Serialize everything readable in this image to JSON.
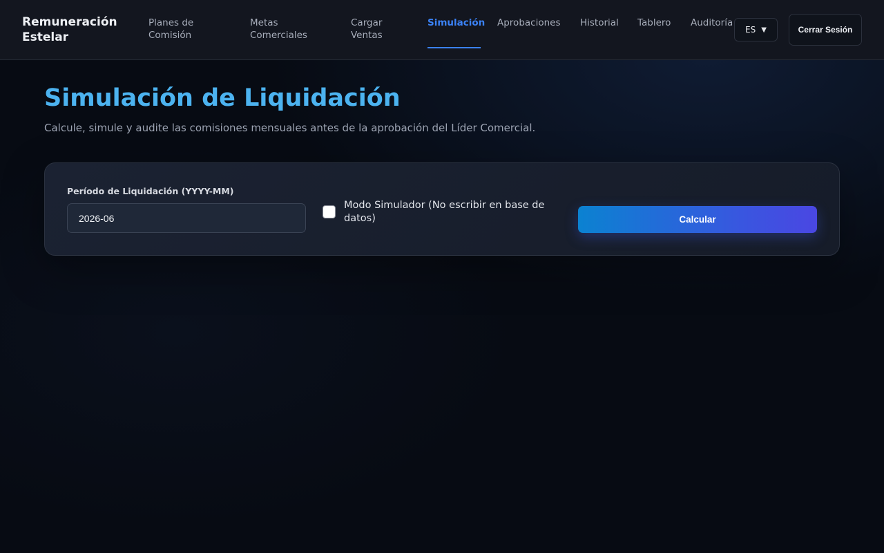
{
  "header": {
    "brand": "Remuneración Estelar",
    "nav": [
      {
        "label": "Planes de Comisión",
        "active": false
      },
      {
        "label": "Metas Comerciales",
        "active": false
      },
      {
        "label": "Cargar Ventas",
        "active": false
      },
      {
        "label": "Simulación",
        "active": true
      },
      {
        "label": "Aprobaciones",
        "active": false
      },
      {
        "label": "Historial",
        "active": false
      },
      {
        "label": "Tablero",
        "active": false
      },
      {
        "label": "Auditoría",
        "active": false
      }
    ],
    "language": {
      "selected": "ES",
      "icon": "chevron-down-icon"
    },
    "logout_label": "Cerrar Sesión"
  },
  "main": {
    "title": "Simulación de Liquidación",
    "subtitle": "Calcule, simule y audite las comisiones mensuales antes de la aprobación del Líder Comercial.",
    "form": {
      "period_label": "Período de Liquidación (YYYY-MM)",
      "period_value": "2026-06",
      "simulator_label": "Modo Simulador (No escribir en base de datos)",
      "simulator_checked": false,
      "calculate_label": "Calcular"
    }
  },
  "colors": {
    "accent": "#3b82f6",
    "title": "#4cb3f0",
    "button_gradient_start": "#0b82d1",
    "button_gradient_end": "#4a47e2",
    "background": "#070b13"
  }
}
